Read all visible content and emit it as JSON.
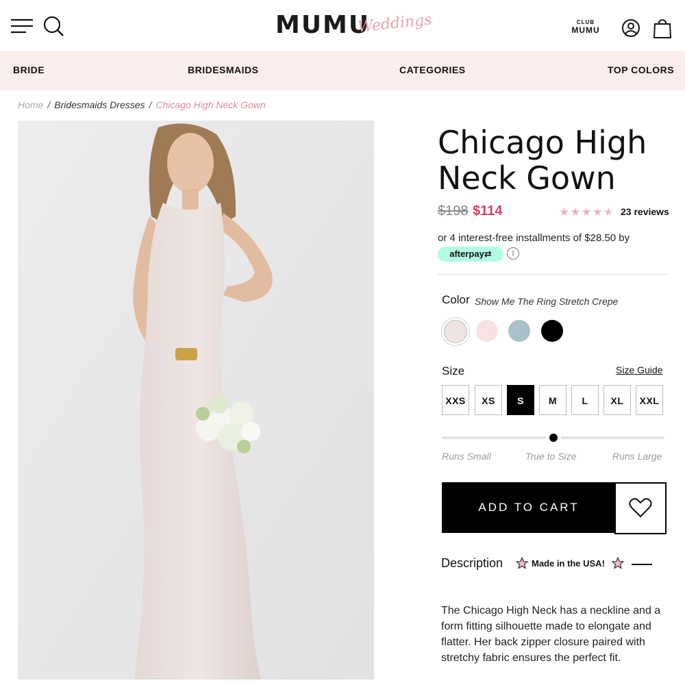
{
  "header": {
    "logo_main": "MUMU",
    "logo_script": "Weddings",
    "club_small": "CLUB",
    "club_big": "MUMU"
  },
  "nav": {
    "items": [
      {
        "label": "BRIDE"
      },
      {
        "label": "BRIDESMAIDS"
      },
      {
        "label": "CATEGORIES"
      },
      {
        "label": "TOP COLORS"
      }
    ]
  },
  "breadcrumb": {
    "home": "Home",
    "separator": "/",
    "middle": "Bridesmaids Dresses",
    "current": "Chicago High Neck Gown"
  },
  "product": {
    "title": "Chicago High Neck Gown",
    "price_old": "$198",
    "price_new": "$114",
    "rating_stars": "★★★★★",
    "reviews": "23 reviews",
    "installments": "or 4 interest-free installments of $28.50 by",
    "afterpay": "afterpay⇄",
    "info_glyph": "i",
    "color_label": "Color",
    "color_value": "Show Me The Ring Stretch Crepe",
    "swatches": [
      {
        "name": "show-me-the-ring",
        "hex": "#efe4e4",
        "selected": true
      },
      {
        "name": "blush",
        "hex": "#f7e3e4",
        "selected": false
      },
      {
        "name": "dusty-blue",
        "hex": "#a9c2c9",
        "selected": false
      },
      {
        "name": "black",
        "hex": "#000000",
        "selected": false
      }
    ],
    "size_label": "Size",
    "size_guide": "Size Guide",
    "sizes": [
      {
        "label": "XXS",
        "selected": false
      },
      {
        "label": "XS",
        "selected": false
      },
      {
        "label": "S",
        "selected": true
      },
      {
        "label": "M",
        "selected": false
      },
      {
        "label": "L",
        "selected": false
      },
      {
        "label": "XL",
        "selected": false
      },
      {
        "label": "XXL",
        "selected": false
      }
    ],
    "fit": {
      "labels": [
        "Runs Small",
        "True to Size",
        "Runs Large"
      ],
      "value": 0.5
    },
    "add_to_cart": "ADD TO CART",
    "description_label": "Description",
    "made_in": "Made in the USA!",
    "description": "The Chicago High Neck has a neckline and a form fitting silhouette made to elongate and flatter. Her back zipper closure paired with stretchy fabric ensures the perfect fit."
  },
  "colors": {
    "nav_bg": "#fceded",
    "price_sale": "#d6406a",
    "breadcrumb_current": "#e08a9a",
    "afterpay": "#b2fce4"
  }
}
